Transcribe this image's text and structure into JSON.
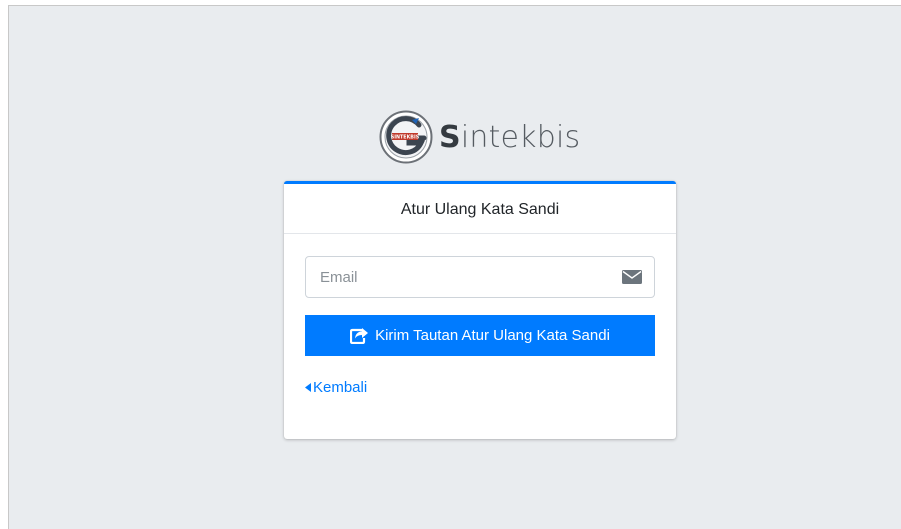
{
  "brand": {
    "first_letter": "S",
    "rest": "intekbis",
    "logo_text": "SINTEKBIS",
    "logo_icon": "sintekbis-logo-icon"
  },
  "card": {
    "title": "Atur Ulang Kata Sandi",
    "email_input": {
      "placeholder": "Email",
      "value": "",
      "icon": "envelope-icon"
    },
    "submit_button": {
      "label": "Kirim Tautan Atur Ulang Kata Sandi",
      "icon": "share-square-icon"
    },
    "back_link": {
      "label": "Kembali",
      "icon": "caret-left-icon"
    }
  },
  "colors": {
    "primary": "#007bff",
    "background": "#e9ecef",
    "card": "#ffffff"
  }
}
